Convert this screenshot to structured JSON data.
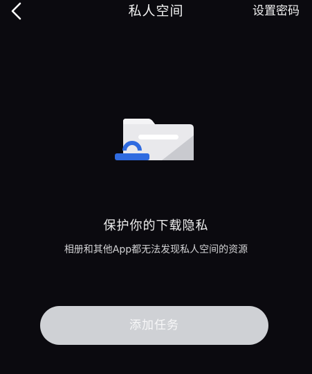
{
  "header": {
    "title": "私人空间",
    "set_password_label": "设置密码",
    "back_icon": "chevron-left-icon"
  },
  "empty_state": {
    "illustration_icon": "folder-lock-icon",
    "headline": "保护你的下载隐私",
    "description": "相册和其他App都无法发现私人空间的资源"
  },
  "actions": {
    "add_task_label": "添加任务"
  },
  "colors": {
    "background": "#0b0a0f",
    "button_bg": "#cfd1d5",
    "accent_blue": "#2f6be0"
  }
}
